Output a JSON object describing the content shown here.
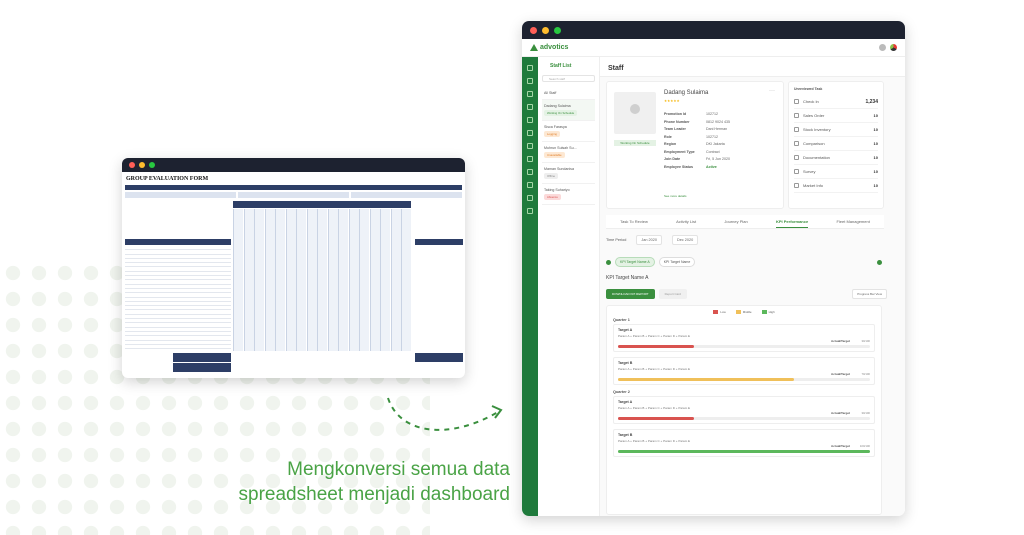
{
  "spreadsheet": {
    "title": "GROUP EVALUATION FORM"
  },
  "dashboard": {
    "brand": "advotics",
    "nav_title": "Staff List",
    "search_placeholder": "Search staff",
    "page_title": "Staff",
    "staff_list": [
      {
        "name": "All Staff",
        "badge": "",
        "badge_type": ""
      },
      {
        "name": "Dadang Sulaima",
        "badge": "Working On Schedule",
        "badge_type": "green"
      },
      {
        "name": "Sisca Farasya",
        "badge": "Logging",
        "badge_type": "orange"
      },
      {
        "name": "Muhrun Sulsah Su...",
        "badge": "Unavailable",
        "badge_type": "orange"
      },
      {
        "name": "Maman Sundanisa",
        "badge": "Offline",
        "badge_type": "grey"
      },
      {
        "name": "Taking Suhariyo",
        "badge": "Absence",
        "badge_type": "red"
      }
    ],
    "profile": {
      "name": "Dadang Sulaima",
      "photo_badge": "Working On Schedule",
      "rows": [
        {
          "k": "Promotion Id",
          "v": "102712"
        },
        {
          "k": "Phone Number",
          "v": "0812 9024 435"
        },
        {
          "k": "Team Leader",
          "v": "Dani Herman"
        },
        {
          "k": "Role",
          "v": "102712"
        },
        {
          "k": "Region",
          "v": "DKI Jakarta"
        },
        {
          "k": "Employment Type",
          "v": "Contract"
        },
        {
          "k": "Join Date",
          "v": "Fri, 5 Jun 2020"
        },
        {
          "k": "Employee Status",
          "v": "Active"
        }
      ],
      "more_link": "See more details"
    },
    "unreviewed": {
      "title": "Unreviewed Task",
      "items": [
        {
          "label": "Check In",
          "count": "1,234"
        },
        {
          "label": "Sales Order",
          "count": "10"
        },
        {
          "label": "Stock Inventory",
          "count": "10"
        },
        {
          "label": "Comparison",
          "count": "10"
        },
        {
          "label": "Documentation",
          "count": "10"
        },
        {
          "label": "Survey",
          "count": "10"
        },
        {
          "label": "Market Info",
          "count": "10"
        }
      ]
    },
    "tabs": [
      "Task To Review",
      "Activity List",
      "Journey Plan",
      "KPI Performance",
      "Fleet Management"
    ],
    "active_tab": "KPI Performance",
    "period": {
      "label": "Time Period",
      "from": "Jan 2020",
      "to": "Dec 2020"
    },
    "kpi_chips": [
      "KPI Target Name A",
      "KPI Target Name"
    ],
    "kpi_name": "KPI Target Name A",
    "download_btn": "DOWNLOAD KPI REPORT",
    "report_btn": "Report Card",
    "view_select": "Progress Bar View",
    "legend": [
      {
        "label": "Low",
        "color": "#d9534f"
      },
      {
        "label": "Middle",
        "color": "#f0c05a"
      },
      {
        "label": "High",
        "color": "#5cb85c"
      }
    ],
    "quarters": [
      {
        "label": "Quarter 1",
        "targets": [
          {
            "name": "Target A",
            "params": "Param A + Param B + Param C + Param D + Param E",
            "actual": "Actual/Target",
            "value": "30/100",
            "progress": 0.3,
            "color": "#d9534f"
          },
          {
            "name": "Target B",
            "params": "Param A + Param B + Param C + Param D + Param E",
            "actual": "Actual/Target",
            "value": "70/100",
            "progress": 0.7,
            "color": "#f0c05a"
          }
        ]
      },
      {
        "label": "Quarter 2",
        "targets": [
          {
            "name": "Target A",
            "params": "Param A + Param B + Param C + Param D + Param E",
            "actual": "Actual/Target",
            "value": "30/100",
            "progress": 0.3,
            "color": "#d9534f"
          },
          {
            "name": "Target B",
            "params": "Param A + Param B + Param C + Param D + Param E",
            "actual": "Actual/Target",
            "value": "100/100",
            "progress": 1.0,
            "color": "#5cb85c"
          }
        ]
      }
    ]
  },
  "caption": {
    "line1": "Mengkonversi semua data",
    "line2": "spreadsheet menjadi dashboard"
  },
  "colors": {
    "accent": "#3a8f3e",
    "caption": "#4aa346",
    "sheet_header": "#2d3e66"
  }
}
